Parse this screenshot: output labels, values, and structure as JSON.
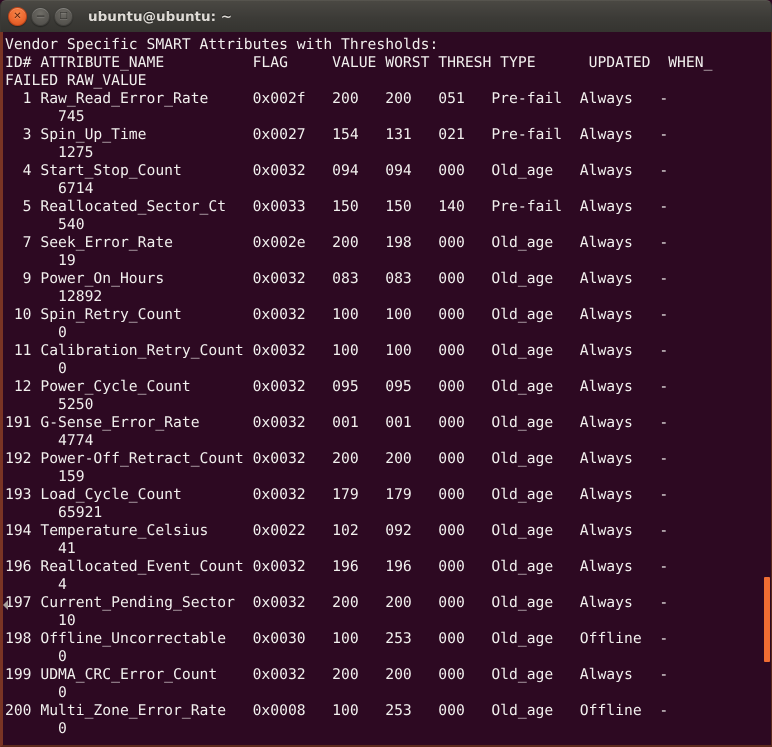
{
  "window": {
    "title": "ubuntu@ubuntu: ~",
    "controls": {
      "close_label": "✕",
      "minimize_label": "−",
      "maximize_label": "□"
    },
    "colors": {
      "titlebar": "#3c3b37",
      "terminal_background": "#2d0922",
      "terminal_foreground": "#f2f0ee",
      "border": "#7a3424",
      "scrollbar_thumb": "#ef6d33",
      "close_button": "#ef6d33"
    }
  },
  "terminal": {
    "heading": "Vendor Specific SMART Attributes with Thresholds:",
    "column_header_line1": "ID# ATTRIBUTE_NAME          FLAG     VALUE WORST THRESH TYPE      UPDATED  WHEN_",
    "column_header_line2": "FAILED RAW_VALUE",
    "columns": [
      "ID#",
      "ATTRIBUTE_NAME",
      "FLAG",
      "VALUE",
      "WORST",
      "THRESH",
      "TYPE",
      "UPDATED",
      "WHEN_FAILED",
      "RAW_VALUE"
    ],
    "rows": [
      {
        "id": "1",
        "name": "Raw_Read_Error_Rate",
        "flag": "0x002f",
        "value": "200",
        "worst": "200",
        "thresh": "051",
        "type": "Pre-fail",
        "updated": "Always",
        "when_failed": "-",
        "raw_value": "745"
      },
      {
        "id": "3",
        "name": "Spin_Up_Time",
        "flag": "0x0027",
        "value": "154",
        "worst": "131",
        "thresh": "021",
        "type": "Pre-fail",
        "updated": "Always",
        "when_failed": "-",
        "raw_value": "1275"
      },
      {
        "id": "4",
        "name": "Start_Stop_Count",
        "flag": "0x0032",
        "value": "094",
        "worst": "094",
        "thresh": "000",
        "type": "Old_age",
        "updated": "Always",
        "when_failed": "-",
        "raw_value": "6714"
      },
      {
        "id": "5",
        "name": "Reallocated_Sector_Ct",
        "flag": "0x0033",
        "value": "150",
        "worst": "150",
        "thresh": "140",
        "type": "Pre-fail",
        "updated": "Always",
        "when_failed": "-",
        "raw_value": "540"
      },
      {
        "id": "7",
        "name": "Seek_Error_Rate",
        "flag": "0x002e",
        "value": "200",
        "worst": "198",
        "thresh": "000",
        "type": "Old_age",
        "updated": "Always",
        "when_failed": "-",
        "raw_value": "19"
      },
      {
        "id": "9",
        "name": "Power_On_Hours",
        "flag": "0x0032",
        "value": "083",
        "worst": "083",
        "thresh": "000",
        "type": "Old_age",
        "updated": "Always",
        "when_failed": "-",
        "raw_value": "12892"
      },
      {
        "id": "10",
        "name": "Spin_Retry_Count",
        "flag": "0x0032",
        "value": "100",
        "worst": "100",
        "thresh": "000",
        "type": "Old_age",
        "updated": "Always",
        "when_failed": "-",
        "raw_value": "0"
      },
      {
        "id": "11",
        "name": "Calibration_Retry_Count",
        "flag": "0x0032",
        "value": "100",
        "worst": "100",
        "thresh": "000",
        "type": "Old_age",
        "updated": "Always",
        "when_failed": "-",
        "raw_value": "0"
      },
      {
        "id": "12",
        "name": "Power_Cycle_Count",
        "flag": "0x0032",
        "value": "095",
        "worst": "095",
        "thresh": "000",
        "type": "Old_age",
        "updated": "Always",
        "when_failed": "-",
        "raw_value": "5250"
      },
      {
        "id": "191",
        "name": "G-Sense_Error_Rate",
        "flag": "0x0032",
        "value": "001",
        "worst": "001",
        "thresh": "000",
        "type": "Old_age",
        "updated": "Always",
        "when_failed": "-",
        "raw_value": "4774"
      },
      {
        "id": "192",
        "name": "Power-Off_Retract_Count",
        "flag": "0x0032",
        "value": "200",
        "worst": "200",
        "thresh": "000",
        "type": "Old_age",
        "updated": "Always",
        "when_failed": "-",
        "raw_value": "159"
      },
      {
        "id": "193",
        "name": "Load_Cycle_Count",
        "flag": "0x0032",
        "value": "179",
        "worst": "179",
        "thresh": "000",
        "type": "Old_age",
        "updated": "Always",
        "when_failed": "-",
        "raw_value": "65921"
      },
      {
        "id": "194",
        "name": "Temperature_Celsius",
        "flag": "0x0022",
        "value": "102",
        "worst": "092",
        "thresh": "000",
        "type": "Old_age",
        "updated": "Always",
        "when_failed": "-",
        "raw_value": "41"
      },
      {
        "id": "196",
        "name": "Reallocated_Event_Count",
        "flag": "0x0032",
        "value": "196",
        "worst": "196",
        "thresh": "000",
        "type": "Old_age",
        "updated": "Always",
        "when_failed": "-",
        "raw_value": "4"
      },
      {
        "id": "197",
        "name": "Current_Pending_Sector",
        "flag": "0x0032",
        "value": "200",
        "worst": "200",
        "thresh": "000",
        "type": "Old_age",
        "updated": "Always",
        "when_failed": "-",
        "raw_value": "10"
      },
      {
        "id": "198",
        "name": "Offline_Uncorrectable",
        "flag": "0x0030",
        "value": "100",
        "worst": "253",
        "thresh": "000",
        "type": "Old_age",
        "updated": "Offline",
        "when_failed": "-",
        "raw_value": "0"
      },
      {
        "id": "199",
        "name": "UDMA_CRC_Error_Count",
        "flag": "0x0032",
        "value": "200",
        "worst": "200",
        "thresh": "000",
        "type": "Old_age",
        "updated": "Always",
        "when_failed": "-",
        "raw_value": "0"
      },
      {
        "id": "200",
        "name": "Multi_Zone_Error_Rate",
        "flag": "0x0008",
        "value": "100",
        "worst": "253",
        "thresh": "000",
        "type": "Old_age",
        "updated": "Offline",
        "when_failed": "-",
        "raw_value": "0"
      }
    ]
  }
}
